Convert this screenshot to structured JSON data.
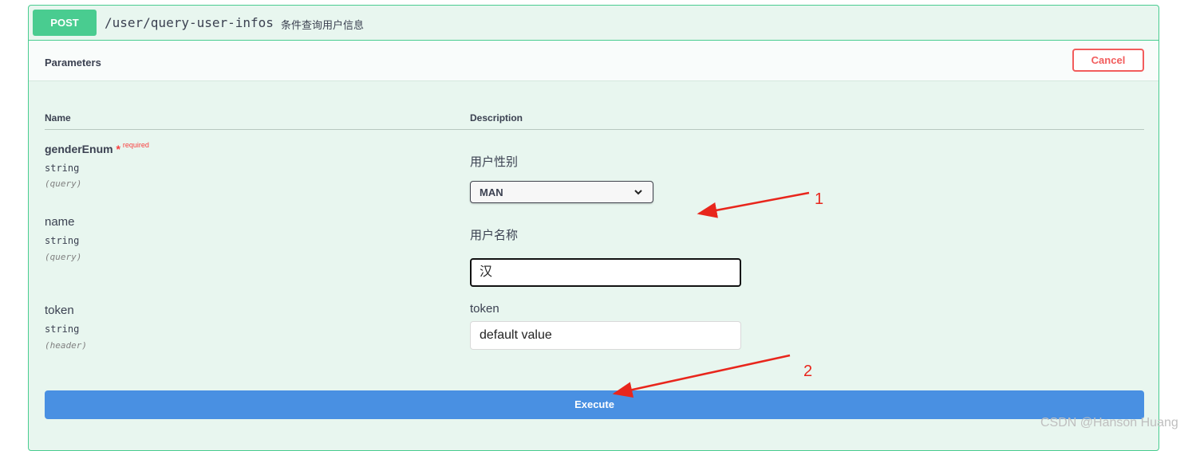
{
  "operation": {
    "method": "POST",
    "path": "/user/query-user-infos",
    "summary": "条件查询用户信息",
    "method_color": "#49cc90"
  },
  "parameters_section": {
    "title": "Parameters",
    "cancel_label": "Cancel"
  },
  "table_headers": {
    "name": "Name",
    "description": "Description"
  },
  "params": [
    {
      "name": "genderEnum",
      "required_star": "*",
      "required_label": "required",
      "type": "string",
      "in": "(query)",
      "description": "用户性别",
      "value": "MAN",
      "icon": "chevron-down-icon"
    },
    {
      "name": "name",
      "type": "string",
      "in": "(query)",
      "description": "用户名称",
      "value": "汉"
    },
    {
      "name": "token",
      "type": "string",
      "in": "(header)",
      "description": "token",
      "value": "default value"
    }
  ],
  "execute_label": "Execute",
  "annotations": [
    "1",
    "2"
  ],
  "watermark": "CSDN @Hanson Huang",
  "colors": {
    "execute": "#4990e2",
    "cancel": "#f25c5c",
    "annotation": "#e8261c"
  }
}
